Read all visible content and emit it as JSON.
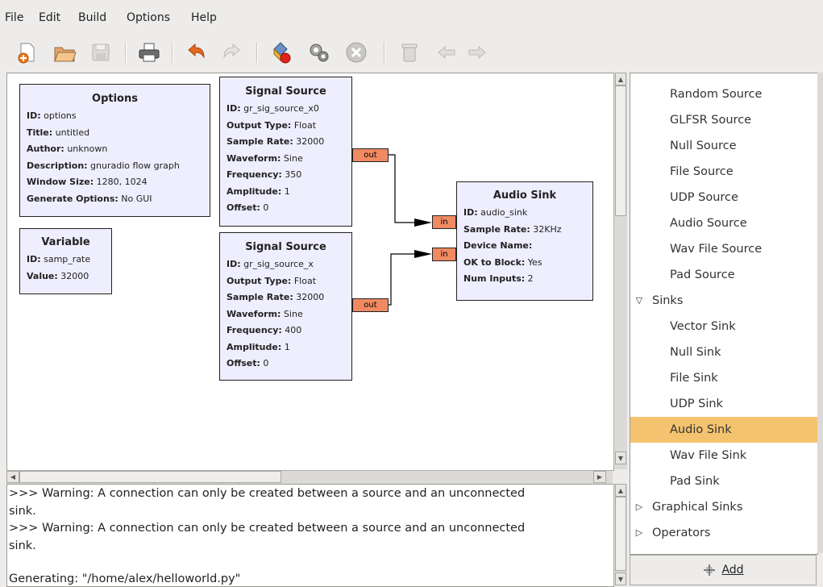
{
  "menubar": {
    "items": [
      "File",
      "Edit",
      "Build",
      "Options",
      "Help"
    ]
  },
  "toolbar": {
    "buttons": [
      "new-icon",
      "open-icon",
      "save-icon",
      "print-icon",
      "undo-icon",
      "redo-icon",
      "generate-icon",
      "execute-icon",
      "kill-icon",
      "delete-icon",
      "rotate-left-icon",
      "rotate-right-icon"
    ]
  },
  "blocks": {
    "options": {
      "title": "Options",
      "params": [
        {
          "k": "ID:",
          "v": " options"
        },
        {
          "k": "Title:",
          "v": " untitled"
        },
        {
          "k": "Author:",
          "v": " unknown"
        },
        {
          "k": "Description:",
          "v": " gnuradio flow graph"
        },
        {
          "k": "Window Size:",
          "v": " 1280, 1024"
        },
        {
          "k": "Generate Options:",
          "v": " No GUI"
        }
      ]
    },
    "variable": {
      "title": "Variable",
      "params": [
        {
          "k": "ID:",
          "v": " samp_rate"
        },
        {
          "k": "Value:",
          "v": " 32000"
        }
      ]
    },
    "sig1": {
      "title": "Signal Source",
      "params": [
        {
          "k": "ID:",
          "v": " gr_sig_source_x0"
        },
        {
          "k": "Output Type:",
          "v": " Float"
        },
        {
          "k": "Sample Rate:",
          "v": " 32000"
        },
        {
          "k": "Waveform:",
          "v": " Sine"
        },
        {
          "k": "Frequency:",
          "v": " 350"
        },
        {
          "k": "Amplitude:",
          "v": " 1"
        },
        {
          "k": "Offset:",
          "v": " 0"
        }
      ],
      "port": "out"
    },
    "sig2": {
      "title": "Signal Source",
      "params": [
        {
          "k": "ID:",
          "v": " gr_sig_source_x"
        },
        {
          "k": "Output Type:",
          "v": " Float"
        },
        {
          "k": "Sample Rate:",
          "v": " 32000"
        },
        {
          "k": "Waveform:",
          "v": " Sine"
        },
        {
          "k": "Frequency:",
          "v": " 400"
        },
        {
          "k": "Amplitude:",
          "v": " 1"
        },
        {
          "k": "Offset:",
          "v": " 0"
        }
      ],
      "port": "out"
    },
    "audio": {
      "title": "Audio Sink",
      "params": [
        {
          "k": "ID:",
          "v": " audio_sink"
        },
        {
          "k": "Sample Rate:",
          "v": " 32KHz"
        },
        {
          "k": "Device Name:",
          "v": ""
        },
        {
          "k": "OK to Block:",
          "v": " Yes"
        },
        {
          "k": "Num Inputs:",
          "v": " 2"
        }
      ],
      "ports": [
        "in",
        "in"
      ]
    }
  },
  "console": {
    "lines": [
      ">>> Warning: A connection can only be created between a source and an unconnected",
      "sink.",
      ">>> Warning: A connection can only be created between a source and an unconnected",
      "sink.",
      "",
      "Generating: \"/home/alex/helloworld.py\""
    ]
  },
  "tree": {
    "items": [
      {
        "label": "Random Source",
        "type": "leaf"
      },
      {
        "label": "GLFSR Source",
        "type": "leaf"
      },
      {
        "label": "Null Source",
        "type": "leaf"
      },
      {
        "label": "File Source",
        "type": "leaf"
      },
      {
        "label": "UDP Source",
        "type": "leaf"
      },
      {
        "label": "Audio Source",
        "type": "leaf"
      },
      {
        "label": "Wav File Source",
        "type": "leaf"
      },
      {
        "label": "Pad Source",
        "type": "leaf"
      },
      {
        "label": "Sinks",
        "type": "cat-open"
      },
      {
        "label": "Vector Sink",
        "type": "leaf"
      },
      {
        "label": "Null Sink",
        "type": "leaf"
      },
      {
        "label": "File Sink",
        "type": "leaf"
      },
      {
        "label": "UDP Sink",
        "type": "leaf"
      },
      {
        "label": "Audio Sink",
        "type": "leaf",
        "selected": true
      },
      {
        "label": "Wav File Sink",
        "type": "leaf"
      },
      {
        "label": "Pad Sink",
        "type": "leaf"
      },
      {
        "label": "Graphical Sinks",
        "type": "cat-closed"
      },
      {
        "label": "Operators",
        "type": "cat-closed"
      }
    ],
    "selection_color": "#f4c36f"
  },
  "add_button": {
    "label": "Add",
    "icon": "add-icon"
  },
  "colors": {
    "block_bg": "#eeeeff",
    "port_bg": "#f08a62",
    "canvas_bg": "#ffffff"
  }
}
